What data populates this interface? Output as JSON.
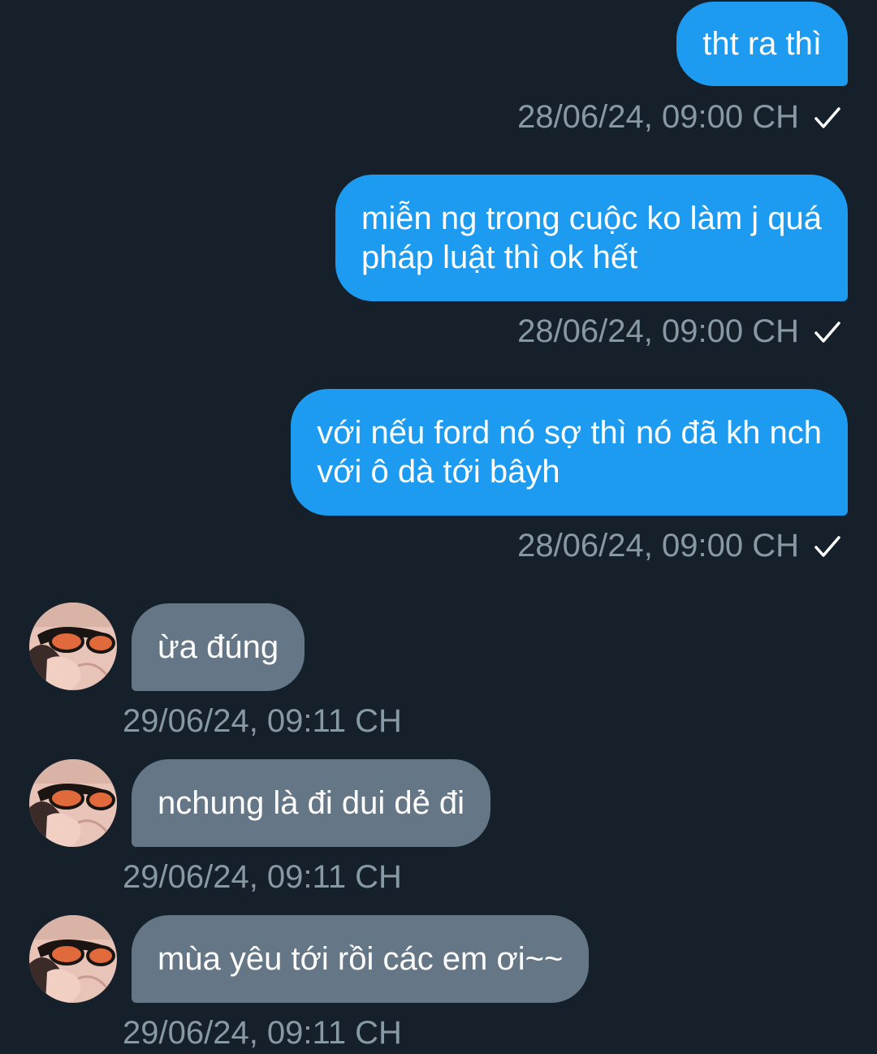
{
  "messages": [
    {
      "direction": "out",
      "lines": [
        "tht ra thì"
      ],
      "timestamp": "28/06/24, 09:00 CH",
      "status_icon": "check-icon"
    },
    {
      "direction": "out",
      "lines": [
        "miễn ng trong cuộc ko làm j quá",
        "pháp luật thì ok hết"
      ],
      "timestamp": "28/06/24, 09:00 CH",
      "status_icon": "check-icon"
    },
    {
      "direction": "out",
      "lines": [
        "với nếu ford nó sợ thì nó đã kh nch",
        "với ô dà tới bâyh"
      ],
      "timestamp": "28/06/24, 09:00 CH",
      "status_icon": "check-icon"
    },
    {
      "direction": "in",
      "lines": [
        "ừa đúng"
      ],
      "timestamp": "29/06/24, 09:11 CH"
    },
    {
      "direction": "in",
      "lines": [
        "nchung là đi dui dẻ đi"
      ],
      "timestamp": "29/06/24, 09:11 CH"
    },
    {
      "direction": "in",
      "lines": [
        "mùa yêu tới rồi các em ơi~~"
      ],
      "timestamp": "29/06/24, 09:11 CH"
    }
  ],
  "colors": {
    "background": "#15202b",
    "outgoing_bubble": "#1d9bf0",
    "incoming_bubble": "#657786",
    "timestamp_text": "#8899a6",
    "message_text": "#ffffff"
  }
}
